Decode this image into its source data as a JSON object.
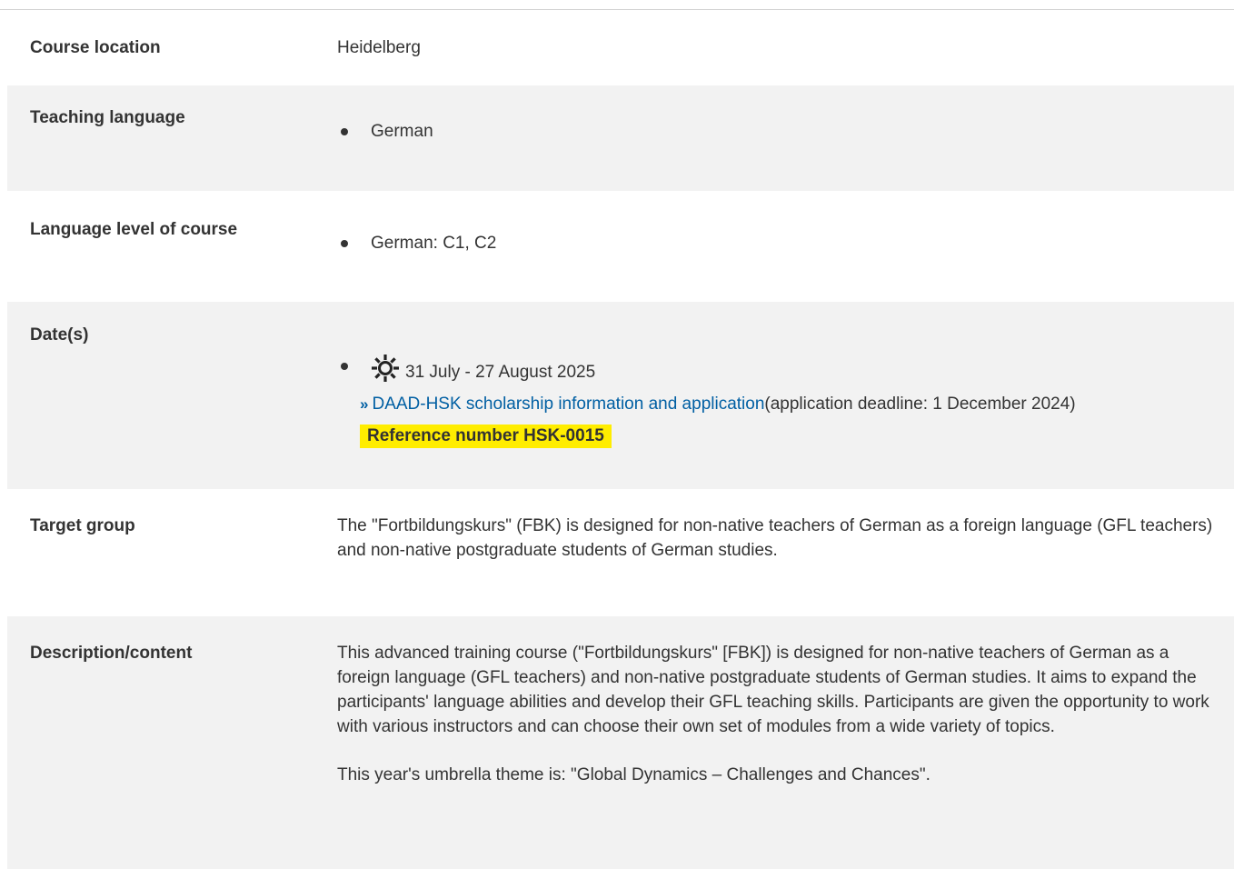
{
  "rows": {
    "location": {
      "label": "Course location",
      "value": "Heidelberg"
    },
    "teaching_language": {
      "label": "Teaching language",
      "items": [
        "German"
      ]
    },
    "language_level": {
      "label": "Language level of course",
      "items": [
        "German: C1, C2"
      ]
    },
    "dates": {
      "label": "Date(s)",
      "icon": "sun-icon",
      "date_text": "31 July - 27 August 2025",
      "link_text": "DAAD-HSK scholarship information and application",
      "link_suffix": "(application deadline: 1 December 2024)",
      "reference": "Reference number HSK-0015"
    },
    "target_group": {
      "label": "Target group",
      "value": "The \"Fortbildungskurs\" (FBK) is designed for non-native teachers of German as a foreign language (GFL teachers) and non-native postgraduate students of German studies."
    },
    "description": {
      "label": "Description/content",
      "paragraph1": "This advanced training course (\"Fortbildungskurs\" [FBK]) is designed for non-native teachers of German as a foreign language (GFL teachers) and non-native postgraduate students of German studies. It aims to expand the participants' language abilities and develop their GFL teaching skills. Participants are given the opportunity to work with various instructors and can choose their own set of modules from a wide variety of topics.",
      "paragraph2": "This year's umbrella theme is: \"Global Dynamics – Challenges and Chances\"."
    }
  },
  "colors": {
    "link": "#005fa3",
    "highlight": "#ffed00",
    "row_alt_bg": "#f2f2f2"
  }
}
